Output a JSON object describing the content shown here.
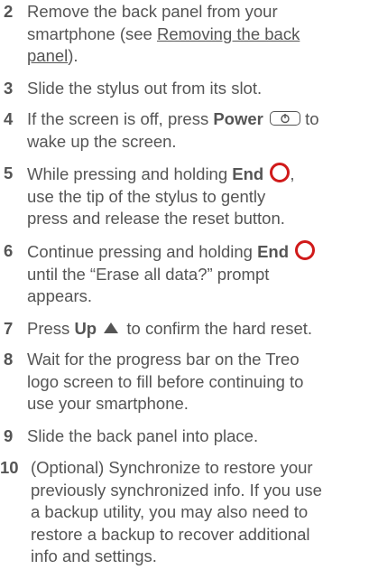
{
  "steps": [
    {
      "number": "2",
      "lines": [
        "Remove the back panel from your",
        "smartphone (see "
      ],
      "link_part1": "Removing the back",
      "link_part2": "panel",
      "after_link": ")."
    },
    {
      "number": "3",
      "text": "Slide the stylus out from its slot."
    },
    {
      "number": "4",
      "pre": "If the screen is off, press ",
      "bold": "Power",
      "post": " to",
      "line2": "wake up the screen."
    },
    {
      "number": "5",
      "pre": "While pressing and holding ",
      "bold": "End",
      "post": ",",
      "line2": "use the tip of the stylus to gently",
      "line3": "press and release the reset button."
    },
    {
      "number": "6",
      "pre": "Continue pressing and holding ",
      "bold": "End",
      "line2": "until the “Erase all data?” prompt",
      "line3": "appears."
    },
    {
      "number": "7",
      "pre": "Press ",
      "bold": "Up",
      "post": " to confirm the hard reset."
    },
    {
      "number": "8",
      "line1": "Wait for the progress bar on the Treo",
      "line2": "logo screen to fill before continuing to",
      "line3": "use your smartphone."
    },
    {
      "number": "9",
      "text": "Slide the back panel into place."
    },
    {
      "number": "10",
      "line1": "(Optional) Synchronize to restore your",
      "line2": "previously synchronized info. If you use",
      "line3": "a backup utility, you may also need to",
      "line4": "restore a backup to recover additional",
      "line5": "info and settings."
    }
  ],
  "icons": {
    "power": "power-button-icon",
    "end": "end-button-icon",
    "up": "up-arrow-icon"
  },
  "colors": {
    "text": "#555555",
    "end_icon": "#d01a1a"
  }
}
